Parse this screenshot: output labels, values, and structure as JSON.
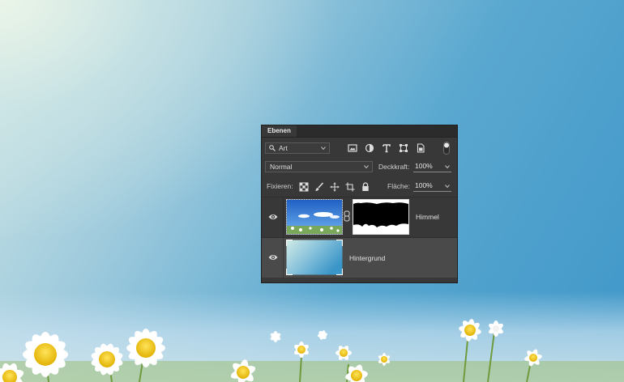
{
  "panel": {
    "tab_label": "Ebenen",
    "filter": {
      "icon": "search-icon",
      "value": "Art",
      "tools": [
        "image-filter-icon",
        "adjustment-filter-icon",
        "type-filter-icon",
        "shape-filter-icon",
        "smart-object-filter-icon",
        "filter-toggle-icon"
      ]
    },
    "blend_mode": "Normal",
    "opacity": {
      "label": "Deckkraft:",
      "value": "100%"
    },
    "lock": {
      "label": "Fixieren:",
      "icons": [
        "lock-transparent-pixels-icon",
        "lock-image-pixels-icon",
        "lock-position-icon",
        "lock-artboard-icon",
        "lock-all-icon"
      ]
    },
    "fill": {
      "label": "Fläche:",
      "value": "100%"
    },
    "layers": [
      {
        "name": "Himmel",
        "visible": true,
        "selected": false,
        "has_mask": true
      },
      {
        "name": "Hintergrund",
        "visible": true,
        "selected": true,
        "has_mask": false
      }
    ]
  },
  "colors": {
    "panel_bg": "#383838",
    "selected_layer": "#4a4a4a",
    "sky_blue": "#3f97c8"
  }
}
